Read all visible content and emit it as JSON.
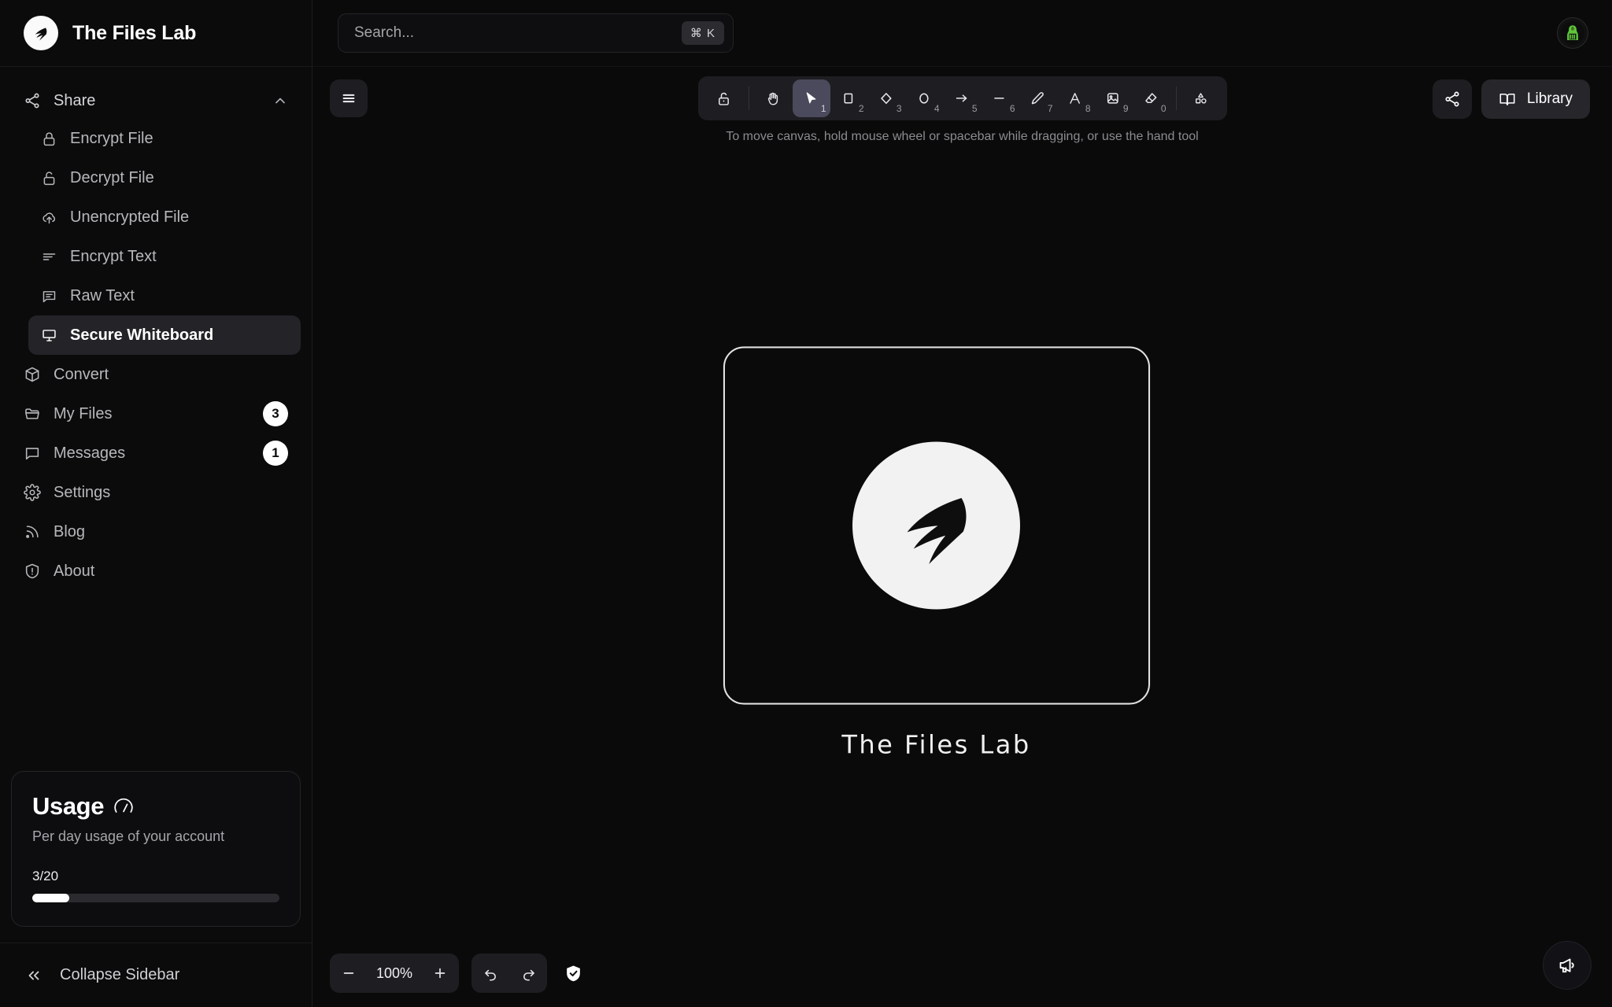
{
  "app": {
    "brand_title": "The Files Lab",
    "accent_white": "#ffffff",
    "background": "#0a0a0a",
    "sidebar_background": "#0b0b0c",
    "panel_background": "#1e1e22",
    "active_tool_background": "#4a4a5c",
    "avatar_accent": "#5fc63a"
  },
  "search": {
    "placeholder": "Search...",
    "value": "",
    "shortcut": "⌘ K"
  },
  "sidebar": {
    "group": {
      "label": "Share",
      "icon": "share-icon",
      "expanded": true,
      "chevron": "chevron-up-icon"
    },
    "sub_items": [
      {
        "label": "Encrypt File",
        "icon": "lock-closed-icon"
      },
      {
        "label": "Decrypt File",
        "icon": "lock-open-icon"
      },
      {
        "label": "Unencrypted File",
        "icon": "cloud-upload-icon"
      },
      {
        "label": "Encrypt Text",
        "icon": "text-lines-icon"
      },
      {
        "label": "Raw Text",
        "icon": "message-square-icon"
      },
      {
        "label": "Secure Whiteboard",
        "icon": "presentation-icon",
        "active": true
      }
    ],
    "items": [
      {
        "label": "Convert",
        "icon": "package-icon",
        "badge": ""
      },
      {
        "label": "My Files",
        "icon": "folder-icon",
        "badge": "3"
      },
      {
        "label": "Messages",
        "icon": "message-circle-icon",
        "badge": "1"
      },
      {
        "label": "Settings",
        "icon": "gear-icon",
        "badge": ""
      },
      {
        "label": "Blog",
        "icon": "rss-icon",
        "badge": ""
      },
      {
        "label": "About",
        "icon": "info-shield-icon",
        "badge": ""
      }
    ],
    "usage": {
      "title": "Usage",
      "title_icon": "gauge-icon",
      "subtitle": "Per day usage of your account",
      "count_label": "3/20",
      "used": 3,
      "total": 20,
      "percent": 15
    },
    "collapse": {
      "label": "Collapse Sidebar",
      "icon": "chevrons-left-icon"
    }
  },
  "canvas": {
    "menu_button_icon": "hamburger-menu-icon",
    "hint": "To move canvas, hold mouse wheel or spacebar while dragging, or use the hand tool",
    "share_button_icon": "share-icon",
    "library_button": {
      "label": "Library",
      "icon": "book-open-icon"
    },
    "drawing": {
      "caption": "The Files Lab",
      "logo_icon": "files-lab-logo-icon",
      "frame_shape": "rounded-rectangle"
    },
    "feedback_fab_icon": "megaphone-icon"
  },
  "toolbar": {
    "tools": [
      {
        "name": "lock",
        "icon": "lock-open-icon",
        "shortcut": "",
        "active": false
      },
      {
        "name": "hand",
        "icon": "hand-icon",
        "shortcut": "",
        "active": false
      },
      {
        "name": "selection",
        "icon": "cursor-arrow-icon",
        "shortcut": "1",
        "active": true
      },
      {
        "name": "rectangle",
        "icon": "square-icon",
        "shortcut": "2",
        "active": false
      },
      {
        "name": "diamond",
        "icon": "diamond-icon",
        "shortcut": "3",
        "active": false
      },
      {
        "name": "ellipse",
        "icon": "circle-icon",
        "shortcut": "4",
        "active": false
      },
      {
        "name": "arrow",
        "icon": "arrow-right-icon",
        "shortcut": "5",
        "active": false
      },
      {
        "name": "line",
        "icon": "minus-icon",
        "shortcut": "6",
        "active": false
      },
      {
        "name": "draw",
        "icon": "pencil-icon",
        "shortcut": "7",
        "active": false
      },
      {
        "name": "text",
        "icon": "letter-a-icon",
        "shortcut": "8",
        "active": false
      },
      {
        "name": "image",
        "icon": "image-icon",
        "shortcut": "9",
        "active": false
      },
      {
        "name": "eraser",
        "icon": "eraser-icon",
        "shortcut": "0",
        "active": false
      },
      {
        "name": "shapes",
        "icon": "shapes-icon",
        "shortcut": "",
        "active": false
      }
    ]
  },
  "bottombar": {
    "zoom_out_icon": "minus-icon",
    "zoom_in_icon": "plus-icon",
    "zoom_level": "100%",
    "undo_icon": "undo-icon",
    "redo_icon": "redo-icon",
    "secure_icon": "shield-check-icon"
  }
}
